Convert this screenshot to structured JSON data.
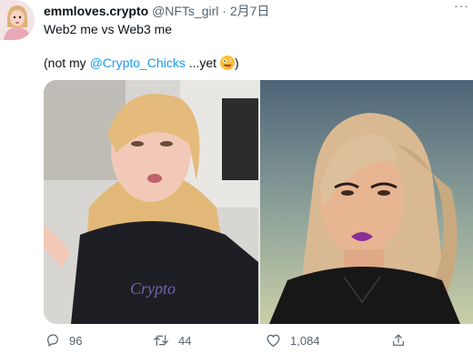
{
  "tweet": {
    "display_name": "emmloves.crypto",
    "handle": "@NFTs_girl",
    "separator": "·",
    "date": "2月7日",
    "more_label": "···",
    "line1": "Web2 me vs Web3 me",
    "line2_prefix": "(not my ",
    "mention": "@Crypto_Chicks",
    "line2_suffix": " ...yet ",
    "line2_end": ")"
  },
  "actions": {
    "reply_count": "96",
    "retweet_count": "44",
    "like_count": "1,084"
  },
  "icons": {
    "reply": "reply-icon",
    "retweet": "retweet-icon",
    "like": "heart-icon",
    "share": "share-icon",
    "emoji": "zany-face-emoji"
  },
  "colors": {
    "accent": "#1d9bf0",
    "secondary_text": "#536471",
    "primary_text": "#0f1419"
  }
}
